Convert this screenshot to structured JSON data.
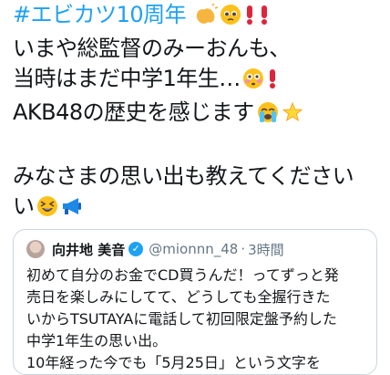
{
  "tweet": {
    "hashtag": "#エビカツ10周年",
    "lines": [
      "いまや総監督のみーおんも、",
      "当時はまだ中学1年生…",
      "AKB48の歴史を感じます",
      "みなさまの思い出も教えてください",
      "い"
    ]
  },
  "quoted_tweet": {
    "name": "向井地 美音",
    "handle": "@mionnn_48",
    "separator": "·",
    "time": "3時間",
    "lines": [
      "初めて自分のお金でCD買うんだ！ってずっと発",
      "売日を楽しみにしてて、どうしても全握行きた",
      "いからTSUTAYAに電話して初回限定盤予約した",
      "中学1年生の思い出。",
      "10年経った今でも「5月25日」という文字を"
    ]
  },
  "colors": {
    "hashtag": "#1da1f2",
    "verified": "#1da1f2",
    "muted": "#657786"
  }
}
